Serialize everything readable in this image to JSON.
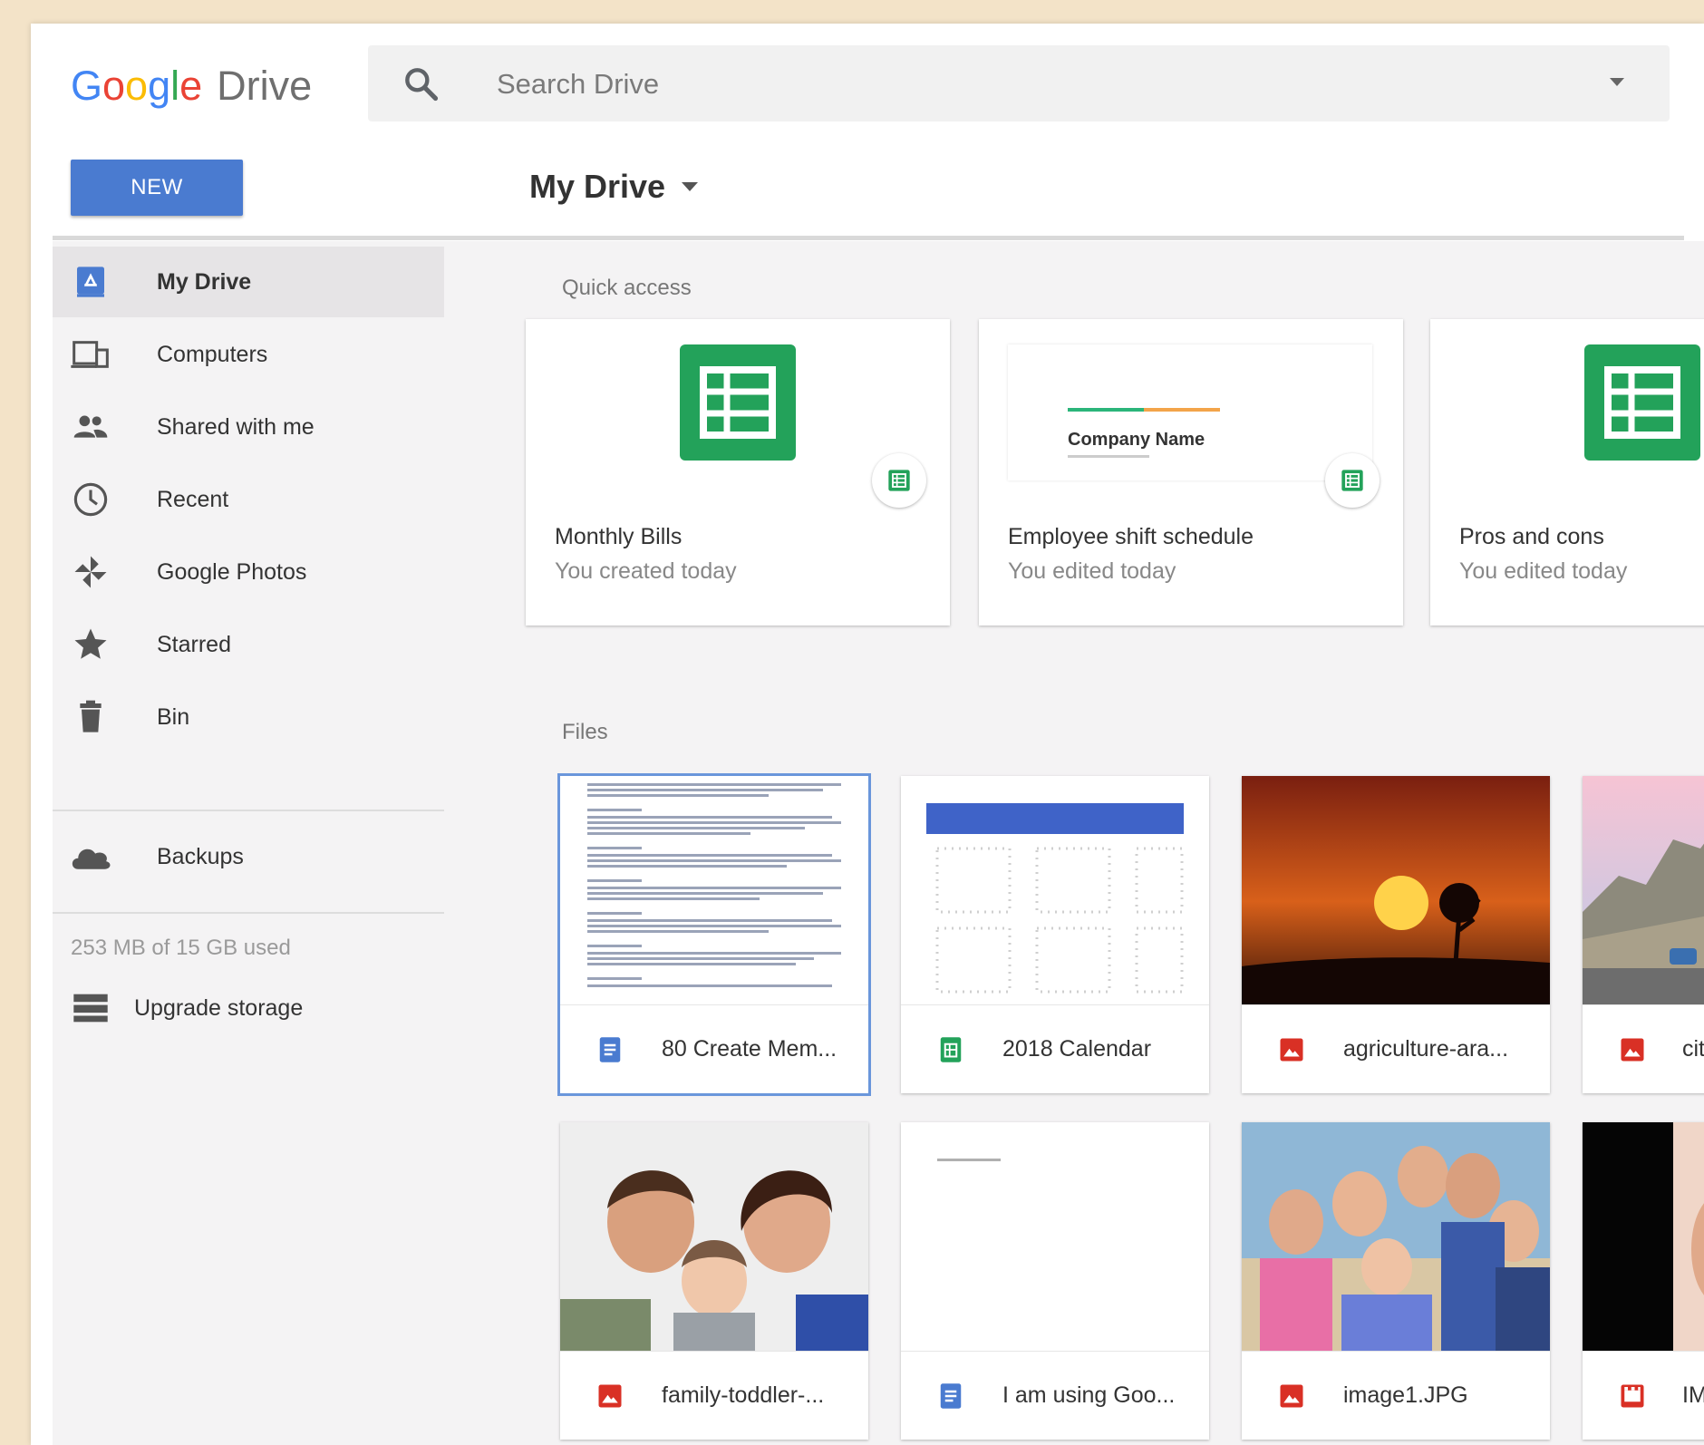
{
  "header": {
    "logo_google": [
      "G",
      "o",
      "o",
      "g",
      "l",
      "e"
    ],
    "logo_drive": "Drive",
    "search_placeholder": "Search Drive",
    "new_button": "NEW",
    "breadcrumb": "My Drive"
  },
  "sidebar": {
    "items": [
      {
        "label": "My Drive",
        "icon": "my-drive-icon",
        "active": true
      },
      {
        "label": "Computers",
        "icon": "computers-icon"
      },
      {
        "label": "Shared with me",
        "icon": "shared-icon"
      },
      {
        "label": "Recent",
        "icon": "clock-icon"
      },
      {
        "label": "Google Photos",
        "icon": "pinwheel-icon"
      },
      {
        "label": "Starred",
        "icon": "star-icon"
      },
      {
        "label": "Bin",
        "icon": "trash-icon"
      }
    ],
    "backups": "Backups",
    "storage": "253 MB of 15 GB used",
    "upgrade": "Upgrade storage"
  },
  "main": {
    "quick_access_title": "Quick access",
    "quick_access": [
      {
        "title": "Monthly Bills",
        "sub": "You created today",
        "type": "sheet"
      },
      {
        "title": "Employee shift schedule",
        "sub": "You edited today",
        "type": "sheet",
        "thumb_text": "Company Name"
      },
      {
        "title": "Pros and cons",
        "sub": "You edited today",
        "type": "sheet"
      }
    ],
    "files_title": "Files",
    "files": [
      {
        "name": "80 Create Mem...",
        "type": "doc"
      },
      {
        "name": "2018 Calendar",
        "type": "sheet"
      },
      {
        "name": "agriculture-ara...",
        "type": "image"
      },
      {
        "name": "cit",
        "type": "image"
      },
      {
        "name": "family-toddler-...",
        "type": "image"
      },
      {
        "name": "I am using Goo...",
        "type": "doc"
      },
      {
        "name": "image1.JPG",
        "type": "image"
      },
      {
        "name": "IM",
        "type": "video"
      }
    ]
  },
  "colors": {
    "accent_blue": "#4a7bd0",
    "sheet_green": "#23a25a",
    "doc_blue": "#4a7bd0",
    "image_red": "#d93025"
  }
}
